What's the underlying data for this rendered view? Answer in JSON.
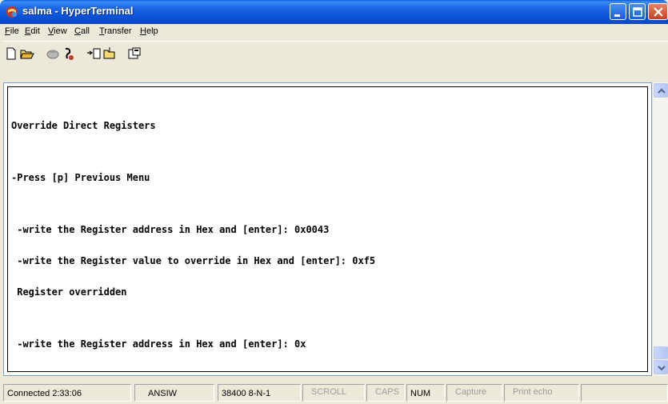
{
  "window": {
    "title": "salma - HyperTerminal"
  },
  "menu": [
    {
      "label": "File",
      "u": "F",
      "rest": "ile"
    },
    {
      "label": "Edit",
      "u": "E",
      "rest": "dit"
    },
    {
      "label": "View",
      "u": "V",
      "rest": "iew"
    },
    {
      "label": "Call",
      "u": "C",
      "rest": "all"
    },
    {
      "label": "Transfer",
      "u": "T",
      "rest": "ransfer"
    },
    {
      "label": "Help",
      "u": "H",
      "rest": "elp"
    }
  ],
  "toolbar": {
    "buttons": [
      "new-icon",
      "open-icon",
      "connect-icon",
      "disconnect-icon",
      "send-icon",
      "receive-icon",
      "properties-icon"
    ]
  },
  "terminal": {
    "lines": [
      "Override Direct Registers",
      "",
      "-Press [p] Previous Menu",
      "",
      " -write the Register address in Hex and [enter]: 0x0043",
      " -write the Register value to override in Hex and [enter]: 0xf5",
      " Register overridden",
      "",
      " -write the Register address in Hex and [enter]: 0x"
    ]
  },
  "status": {
    "connected": "Connected 2:33:06",
    "emulation": "ANSIW",
    "port": "38400 8-N-1",
    "scroll": "SCROLL",
    "caps": "CAPS",
    "num": "NUM",
    "capture": "Capture",
    "print_echo": "Print echo"
  },
  "colors": {
    "titlebar": "#0a52d8",
    "close_button": "#c5401e",
    "terminal_bg": "#ffffff",
    "chrome_bg": "#ece9d8"
  }
}
